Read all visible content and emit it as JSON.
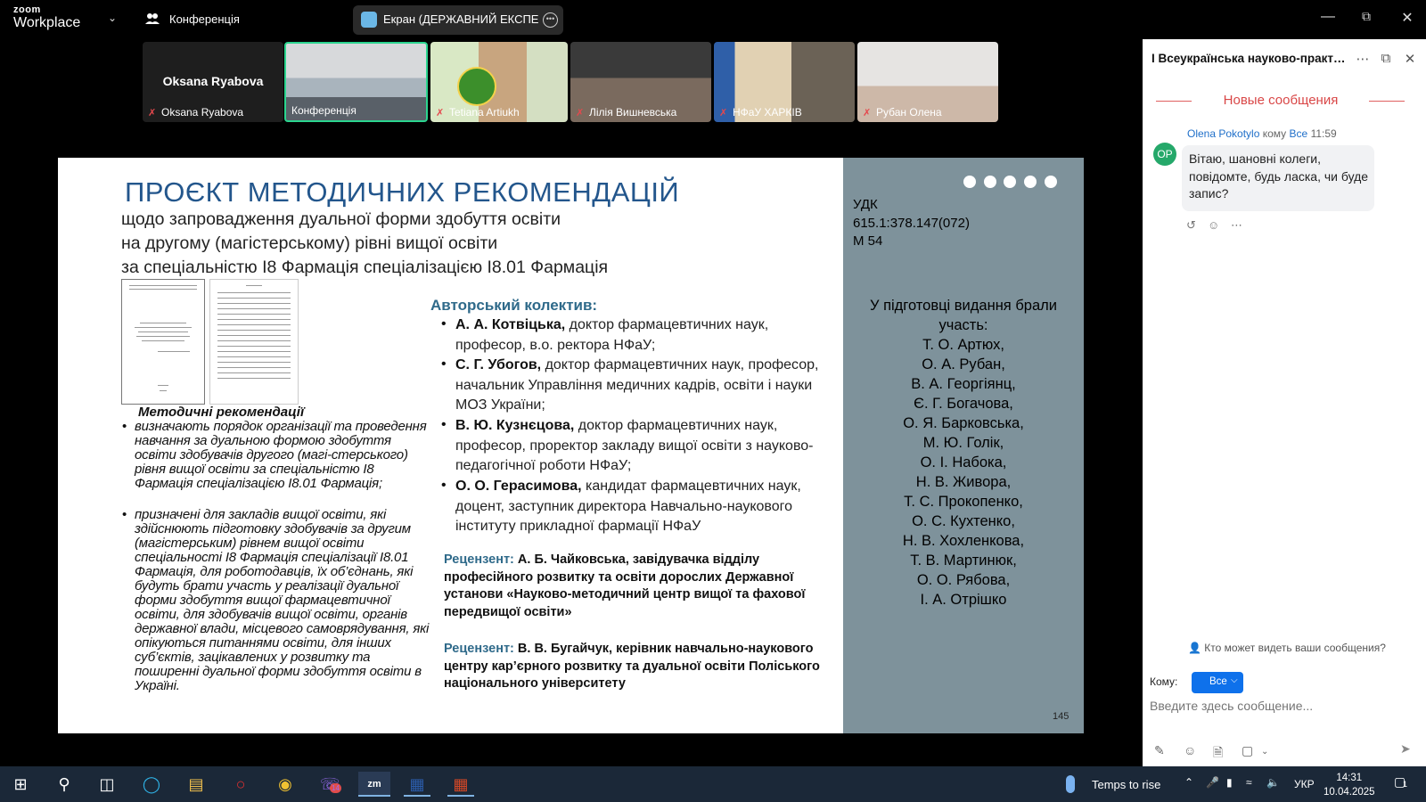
{
  "app": {
    "brand_line1": "zoom",
    "brand_line2": "Workplace",
    "meeting_name": "Конференція",
    "share_label": "Екран (ДЕРЖАВНИЙ ЕКСПЕРТНИЙ"
  },
  "participants": [
    {
      "name": "Oksana Ryabova",
      "big_name": "Oksana Ryabova"
    },
    {
      "name": "Конференція"
    },
    {
      "name": "Tetiana Artiukh"
    },
    {
      "name": "Лілія Вишневська"
    },
    {
      "name": "НФаУ ХАРКІВ"
    },
    {
      "name": "Рубан Олена"
    }
  ],
  "slide": {
    "title": "ПРОЄКТ МЕТОДИЧНИХ РЕКОМЕНДАЦІЙ",
    "subtitle_lines": [
      "щодо запровадження дуальної форми здобуття освіти",
      "на другому (магістерському) рівні вищої освіти",
      "за спеціальністю І8 Фармація спеціалізацією І8.01 Фармація"
    ],
    "mr_heading": "Методичні рекомендації",
    "mr_bullets": [
      "визначають порядок організації та проведення навчання за дуальною формою здобуття освіти здобувачів другого (магі-стерського) рівня вищої освіти за спеціальністю І8 Фармація спеціалізацією І8.01 Фармація;",
      "призначені для закладів вищої освіти, які здійснюють підготовку здобувачів за другим (магістерським) рівнем вищої освіти спеціальності І8 Фармація спеціалізації І8.01 Фармація, для роботодавців, їх об’єднань, які будуть брати участь у реалізації дуальної форми здобуття вищої фармацевтичної освіти, для здобувачів вищої освіти, органів державної влади, місцевого самоврядування, які опікуються питаннями освіти, для інших суб’єктів, зацікавлених у розвитку та поширенні дуальної форми здобуття освіти в Україні."
    ],
    "authors_heading": "Авторський колектив:",
    "authors": [
      {
        "name": "А. А. Котвіцька,",
        "desc": " доктор фармацевтичних наук, професор, в.о. ректора НФаУ;"
      },
      {
        "name": "С. Г. Убогов,",
        "desc": " доктор фармацевтичних наук, професор, начальник Управління медичних кадрів, освіти і науки МОЗ України;"
      },
      {
        "name": "В. Ю. Кузнєцова,",
        "desc": " доктор фармацевтичних наук, професор, проректор закладу вищої освіти з науково-педагогічної роботи НФаУ;"
      },
      {
        "name": "О. О. Герасимова,",
        "desc": " кандидат фармацевтичних наук, доцент, заступник директора Навчально-наукового інституту прикладної фармації НФаУ"
      }
    ],
    "reviewers": [
      {
        "label": "Рецензент:",
        "text": " А. Б. Чайковська, завідувачка відділу професійного розвитку та освіти дорослих Державної установи «Науково-методичний центр вищої та фахової передвищої освіти»"
      },
      {
        "label": "Рецензент:",
        "text": " В. В. Бугайчук, керівник навчально-наукового центру кар’єрного розвитку та дуальної освіти Поліського національного університету"
      }
    ],
    "udk": "УДК\n615.1:378.147(072)\nМ 54",
    "prep_heading": "У підготовці видання брали участь:",
    "prep_names": [
      "Т. О. Артюх,",
      "О. А. Рубан,",
      "В. А. Георгіянц,",
      "Є. Г. Богачова,",
      "О. Я. Барковська,",
      "М. Ю. Голік,",
      "О. І. Набока,",
      "Н. В. Живора,",
      "Т. С. Прокопенко,",
      "О. С. Кухтенко,",
      "Н. В. Хохленкова,",
      "Т. В. Мартинюк,",
      "О. О. Рябова,",
      "І. А. Отрішко"
    ],
    "page_number": "145"
  },
  "chat": {
    "title": "І Всеукраїнська науково-практична...",
    "new_messages": "Новые сообщения",
    "avatar_initials": "OP",
    "sender": "Olena Pokotylo",
    "to_word": "кому",
    "target": "Все",
    "time": "11:59",
    "message": "Вітаю, шановні колеги, повідомте, будь ласка, чи буде запис?",
    "who_sees": "Кто может видеть ваши сообщения?",
    "to_label": "Кому:",
    "to_value": "Все",
    "input_placeholder": "Введите здесь сообщение..."
  },
  "taskbar": {
    "weather": "Temps to rise",
    "language": "УКР",
    "time": "14:31",
    "date": "10.04.2025",
    "viber_badge": "14",
    "notifications": "1"
  }
}
